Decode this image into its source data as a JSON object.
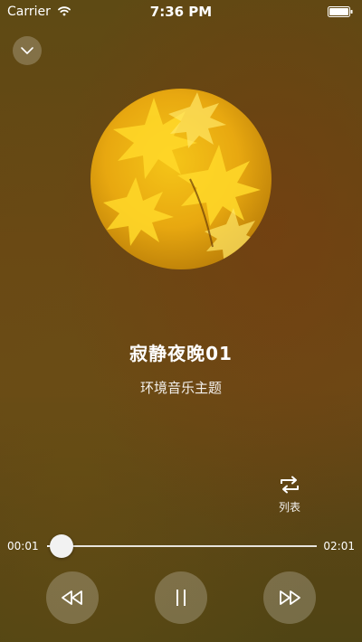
{
  "status_bar": {
    "carrier": "Carrier",
    "time": "7:36 PM",
    "wifi_icon": "wifi-icon",
    "battery_icon": "battery-icon"
  },
  "header": {
    "collapse_icon": "chevron-down-icon"
  },
  "song": {
    "title": "寂静夜晚01",
    "subtitle": "环境音乐主题"
  },
  "playlist": {
    "icon": "repeat-icon",
    "label": "列表"
  },
  "progress": {
    "current": "00:01",
    "total": "02:01",
    "fraction": 0.01
  },
  "controls": {
    "previous_icon": "rewind-icon",
    "play_pause_icon": "pause-icon",
    "next_icon": "fast-forward-icon"
  },
  "colors": {
    "background": "#664816",
    "album_art": "#f5c518",
    "button_fill": "rgba(255,255,255,0.22)",
    "text": "#ffffff"
  }
}
